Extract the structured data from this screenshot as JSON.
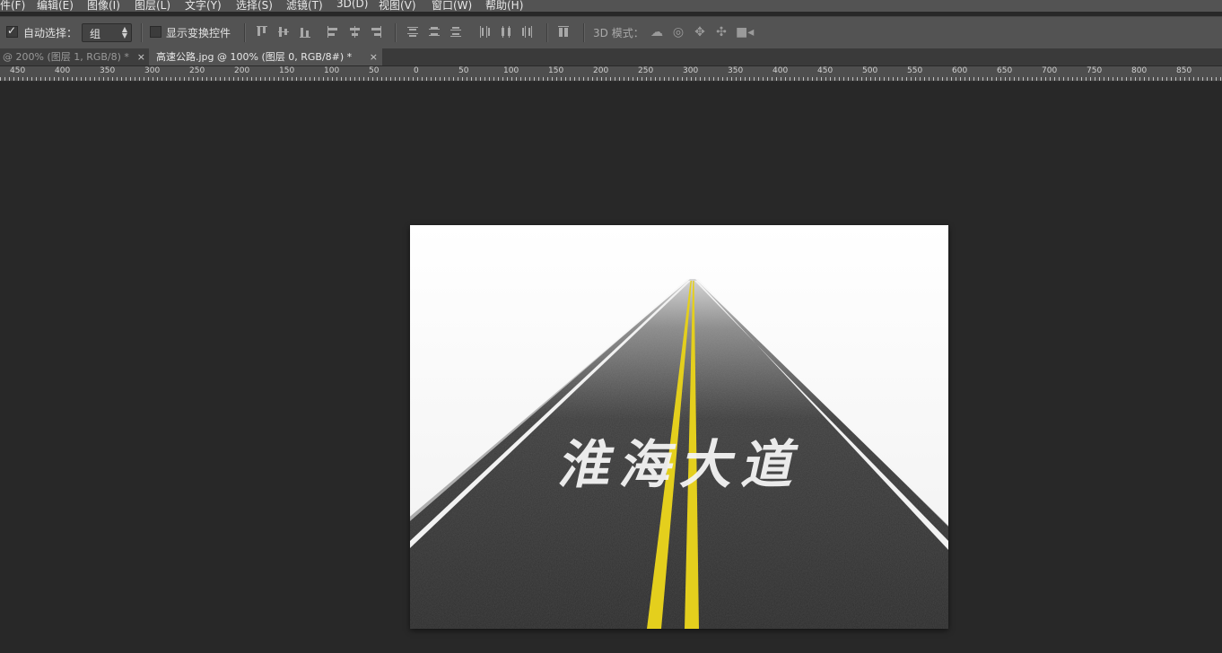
{
  "menu": {
    "items": [
      "件(F)",
      "编辑(E)",
      "图像(I)",
      "图层(L)",
      "文字(Y)",
      "选择(S)",
      "滤镜(T)",
      "3D(D)",
      "视图(V)",
      "窗口(W)",
      "帮助(H)"
    ]
  },
  "options": {
    "auto_select_label": "自动选择：",
    "auto_select_checked": true,
    "group_select_value": "组",
    "show_transform_label": "显示变换控件",
    "show_transform_checked": false,
    "mode_3d_label": "3D 模式："
  },
  "tabs": [
    {
      "label": "@ 200% (图层 1, RGB/8) *",
      "close": "×",
      "active": false
    },
    {
      "label": "高速公路.jpg @ 100% (图层 0, RGB/8#) *",
      "close": "×",
      "active": true
    }
  ],
  "ruler": {
    "ticks": [
      "450",
      "400",
      "350",
      "300",
      "250",
      "200",
      "150",
      "100",
      "50",
      "0",
      "50",
      "100",
      "150",
      "200",
      "250",
      "300",
      "350",
      "400",
      "450",
      "500",
      "550",
      "600",
      "650",
      "700",
      "750",
      "800",
      "850"
    ]
  },
  "image": {
    "road_text": "淮海大道"
  },
  "colors": {
    "menubar": "#535353",
    "workspace": "#282828",
    "asphalt": "#2f2f2f",
    "lane_yellow": "#e4cf1d"
  }
}
